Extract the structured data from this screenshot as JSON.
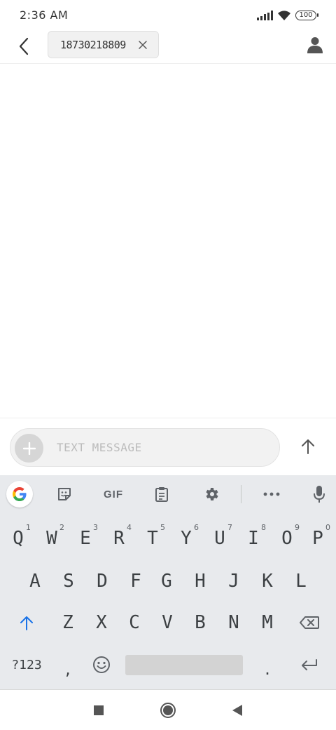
{
  "status_bar": {
    "time": "2:36 AM",
    "battery": "100",
    "icons": [
      "signal-icon",
      "wifi-icon",
      "battery-icon"
    ]
  },
  "header": {
    "recipient": "18730218809",
    "icons": [
      "back-arrow-icon",
      "chip-close-icon",
      "contact-icon"
    ]
  },
  "compose": {
    "placeholder": "TEXT MESSAGE",
    "icons": [
      "add-icon",
      "send-arrow-icon"
    ]
  },
  "keyboard": {
    "toolbar": {
      "gif_label": "GIF",
      "icons": [
        "google-icon",
        "sticker-icon",
        "clipboard-icon",
        "settings-gear-icon",
        "more-dots-icon",
        "microphone-icon"
      ]
    },
    "row1": [
      {
        "label": "Q",
        "hint": "1"
      },
      {
        "label": "W",
        "hint": "2"
      },
      {
        "label": "E",
        "hint": "3"
      },
      {
        "label": "R",
        "hint": "4"
      },
      {
        "label": "T",
        "hint": "5"
      },
      {
        "label": "Y",
        "hint": "6"
      },
      {
        "label": "U",
        "hint": "7"
      },
      {
        "label": "I",
        "hint": "8"
      },
      {
        "label": "O",
        "hint": "9"
      },
      {
        "label": "P",
        "hint": "0"
      }
    ],
    "row2": [
      "A",
      "S",
      "D",
      "F",
      "G",
      "H",
      "J",
      "K",
      "L"
    ],
    "row3": [
      "Z",
      "X",
      "C",
      "V",
      "B",
      "N",
      "M"
    ],
    "symbols_label": "?123",
    "comma": ",",
    "period": ".",
    "accent_color": "#1a73e8"
  },
  "nav_bar": {
    "icons": [
      "recents-square-icon",
      "home-circle-icon",
      "back-triangle-icon"
    ]
  }
}
